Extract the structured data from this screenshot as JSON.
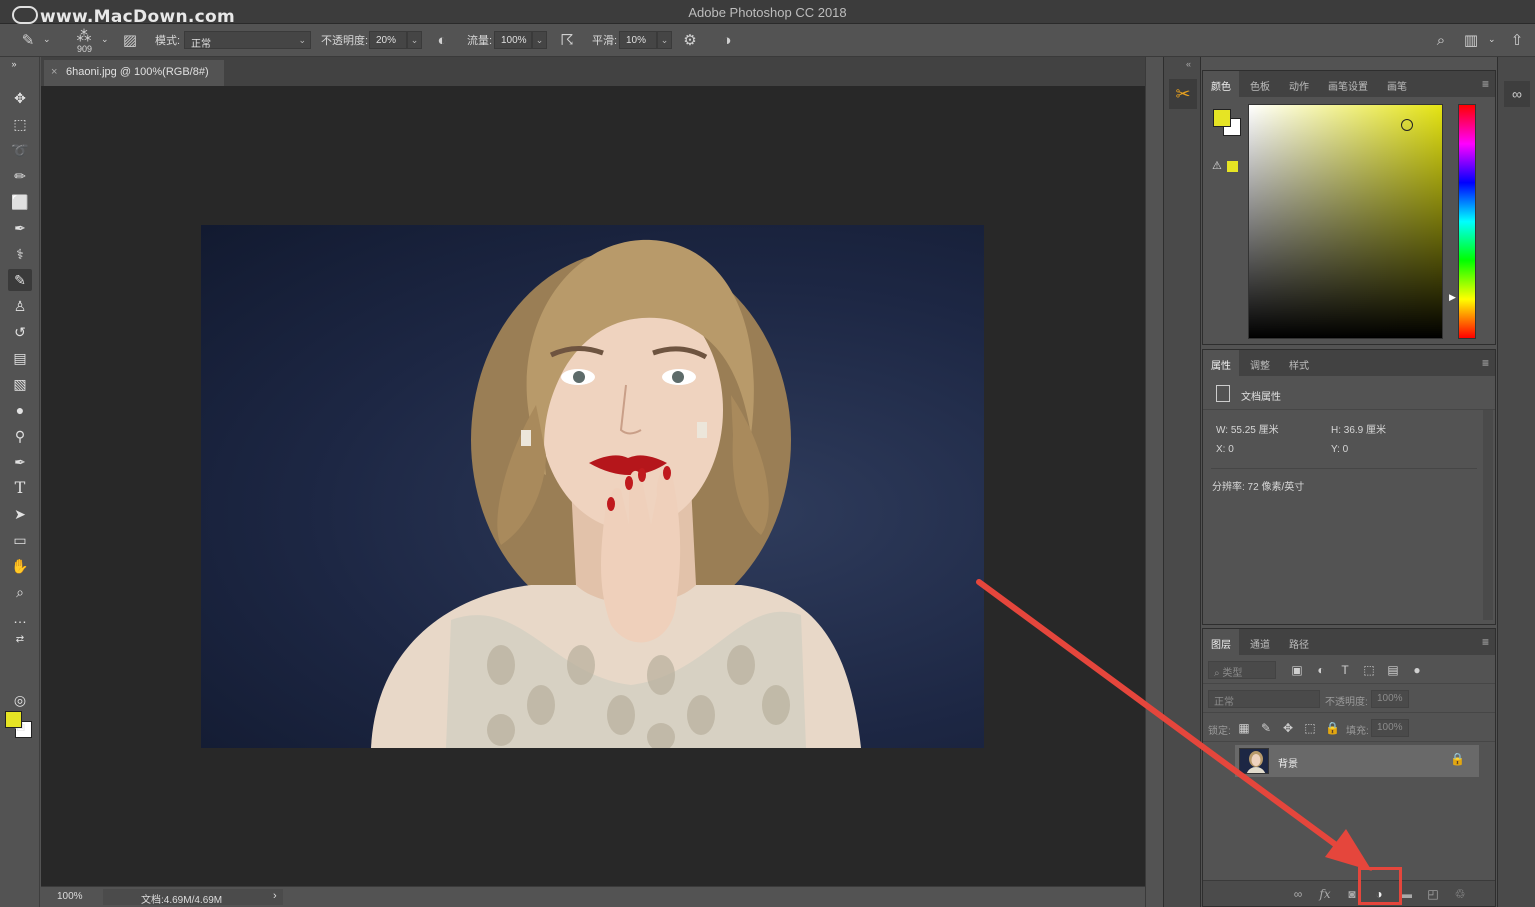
{
  "watermark": "www.MacDown.com",
  "window": {
    "title": "Adobe Photoshop CC 2018"
  },
  "options_bar": {
    "brush_size": "909",
    "mode_label": "模式:",
    "mode_value": "正常",
    "opacity_label": "不透明度:",
    "opacity_value": "20%",
    "flow_label": "流量:",
    "flow_value": "100%",
    "smoothing_label": "平滑:",
    "smoothing_value": "10%"
  },
  "document": {
    "tab_title": "6haoni.jpg @ 100%(RGB/8#)",
    "close_glyph": "×",
    "zoom": "100%",
    "doc_size": "文档:4.69M/4.69M",
    "status_arrow": "›"
  },
  "color_panel": {
    "tabs": [
      "颜色",
      "色板",
      "动作",
      "画笔设置",
      "画笔"
    ],
    "fg_color": "#e6e424",
    "bg_color": "#ffffff"
  },
  "properties_panel": {
    "tabs": [
      "属性",
      "调整",
      "样式"
    ],
    "header": "文档属性",
    "w": "W:  55.25 厘米",
    "h": "H:  36.9 厘米",
    "x": "X:  0",
    "y": "Y:  0",
    "resolution": "分辨率: 72 像素/英寸"
  },
  "layers_panel": {
    "tabs": [
      "图层",
      "通道",
      "路径"
    ],
    "filter_placeholder": "类型",
    "blend_mode": "正常",
    "opacity_label": "不透明度:",
    "opacity_value": "100%",
    "lock_label": "锁定:",
    "fill_label": "填充:",
    "fill_value": "100%",
    "layer_name": "背景"
  },
  "accent_colors": {
    "annotation": "#e5463c",
    "foreground": "#e6e424"
  }
}
